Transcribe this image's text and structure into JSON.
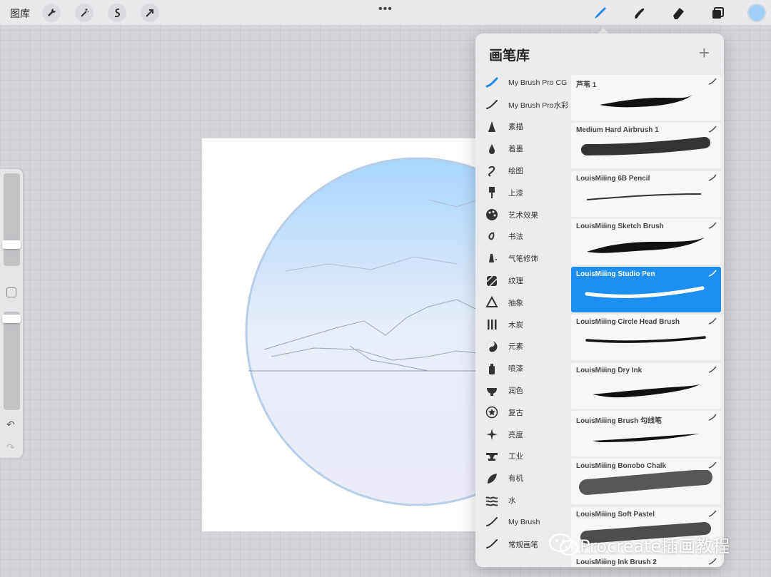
{
  "topbar": {
    "gallery_label": "图库",
    "left_tools": [
      "wrench-icon",
      "magic-wand-icon",
      "selection-icon",
      "transform-arrow-icon"
    ],
    "right_tools": [
      "brush-icon",
      "smudge-icon",
      "eraser-icon",
      "layers-icon"
    ],
    "active_tool": "brush-icon",
    "color": "#9fd0fb"
  },
  "popover": {
    "title": "画笔库",
    "add_label": "+",
    "categories": [
      {
        "label": "My Brush Pro CG",
        "icon": "brush-stroke-icon",
        "active": true
      },
      {
        "label": "My Brush Pro水彩",
        "icon": "brush-stroke-icon"
      },
      {
        "label": "素描",
        "icon": "pencil-tip-icon"
      },
      {
        "label": "着墨",
        "icon": "ink-drop-icon"
      },
      {
        "label": "绘图",
        "icon": "squiggle-icon"
      },
      {
        "label": "上漆",
        "icon": "paint-brush-icon"
      },
      {
        "label": "艺术效果",
        "icon": "palette-icon"
      },
      {
        "label": "书法",
        "icon": "calligraphy-icon"
      },
      {
        "label": "气笔修饰",
        "icon": "airbrush-icon"
      },
      {
        "label": "纹理",
        "icon": "texture-icon"
      },
      {
        "label": "抽象",
        "icon": "triangle-icon"
      },
      {
        "label": "木炭",
        "icon": "charcoal-icon"
      },
      {
        "label": "元素",
        "icon": "yin-yang-icon"
      },
      {
        "label": "喷漆",
        "icon": "spray-can-icon"
      },
      {
        "label": "润色",
        "icon": "bowl-icon"
      },
      {
        "label": "复古",
        "icon": "star-badge-icon"
      },
      {
        "label": "亮度",
        "icon": "sparkle-icon"
      },
      {
        "label": "工业",
        "icon": "anvil-icon"
      },
      {
        "label": "有机",
        "icon": "leaf-icon"
      },
      {
        "label": "水",
        "icon": "waves-icon"
      },
      {
        "label": "My Brush",
        "icon": "brush-stroke-icon"
      },
      {
        "label": "常规画笔",
        "icon": "brush-stroke-icon"
      }
    ],
    "brushes": [
      {
        "name": "芦苇 1",
        "selected": false
      },
      {
        "name": "Medium Hard Airbrush 1",
        "selected": false
      },
      {
        "name": "LouisMiiing 6B Pencil",
        "selected": false
      },
      {
        "name": "LouisMiiing Sketch Brush",
        "selected": false
      },
      {
        "name": "LouisMiiing Studio Pen",
        "selected": true
      },
      {
        "name": "LouisMiiing Circle Head Brush",
        "selected": false
      },
      {
        "name": "LouisMiiing Dry Ink",
        "selected": false
      },
      {
        "name": "LouisMiiing Brush 勾线笔",
        "selected": false
      },
      {
        "name": "LouisMiiing Bonobo Chalk",
        "selected": false
      },
      {
        "name": "LouisMiiing Soft Pastel",
        "selected": false
      },
      {
        "name": "LouisMiiing Ink Brush 2",
        "selected": false
      }
    ]
  },
  "watermark": {
    "text": "Procreate插画教程"
  }
}
